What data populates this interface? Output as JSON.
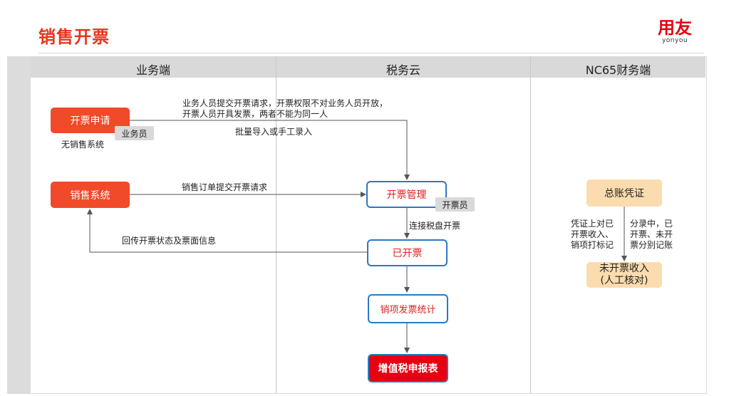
{
  "page": {
    "title": "销售开票"
  },
  "logo": {
    "cn": "用友",
    "en": "yonyou"
  },
  "lanes": [
    "业务端",
    "税务云",
    "NC65财务端"
  ],
  "nodes": {
    "invoice_apply": "开票申请",
    "salesperson_tag": "业务员",
    "no_sales_system": "无销售系统",
    "sales_system": "销售系统",
    "invoice_manage": "开票管理",
    "invoicer_tag": "开票员",
    "invoiced": "已开票",
    "output_invoice_stats": "销项发票统计",
    "vat_report": "增值税申报表",
    "gl_voucher": "总账凭证",
    "unbilled_income": "未开票收入\n(人工核对)"
  },
  "notes": {
    "apply_line1": "业务人员提交开票请求，开票权限不对业务人员开放，",
    "apply_line2": "开票人员开具发票，两者不能为同一人",
    "batch_import": "批量导入或手工录入",
    "order_submit": "销售订单提交开票请求",
    "return_info": "回传开票状态及票面信息",
    "tax_disk": "连接税盘开票",
    "voucher_left": "凭证上对已\n开票收入、\n销项打标记",
    "voucher_right": "分录中，已\n开票、未开\n票分别记账"
  },
  "colors": {
    "brand_red": "#e8341c",
    "box_red": "#f04a2a",
    "box_blue": "#2a79c2",
    "final_red": "#e60012",
    "peach": "#fbdcae"
  }
}
